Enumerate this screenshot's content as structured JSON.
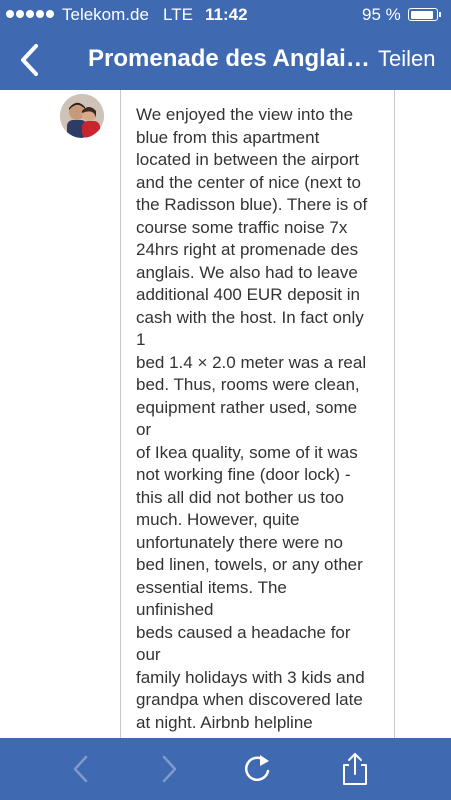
{
  "status_bar": {
    "carrier": "Telekom.de",
    "network": "LTE",
    "time": "11:42",
    "battery": "95 %",
    "battery_level": 0.95
  },
  "nav": {
    "back_icon": "chevron-left-icon",
    "title": "Promenade des Anglai…",
    "share_label": "Teilen"
  },
  "review": {
    "avatar_icon": "user-avatar",
    "text": "We enjoyed the view into the\nblue from this apartment\nlocated in between the airport\nand the center of nice (next to\nthe Radisson blue). There is of\ncourse some traffic noise 7x\n24hrs right at promenade des\nanglais. We also had to leave\nadditional 400 EUR deposit in\ncash with the host. In fact only 1\nbed 1.4 × 2.0 meter was a real\nbed. Thus, rooms were clean,\nequipment rather used, some or\nof Ikea quality, some of it was\nnot working fine (door lock) -\nthis all did not bother us too\nmuch. However, quite\nunfortunately there were no\nbed linen, towels, or any other\nessential items. The unfinished\nbeds caused a headache for our\nfamily holidays with 3 kids and\ngrandpa when discovered late\nat night. Airbnb helpline\nconfirmed that this is not\nsupposed to be that way.\nCurrently I'm still waiting for\ntheir response on my final"
  },
  "toolbar": {
    "back_icon": "arrow-back-icon",
    "forward_icon": "arrow-forward-icon",
    "reload_icon": "reload-icon",
    "share_icon": "share-icon"
  },
  "colors": {
    "bar": "#3f69b0",
    "disabled": "#7f9acc"
  }
}
